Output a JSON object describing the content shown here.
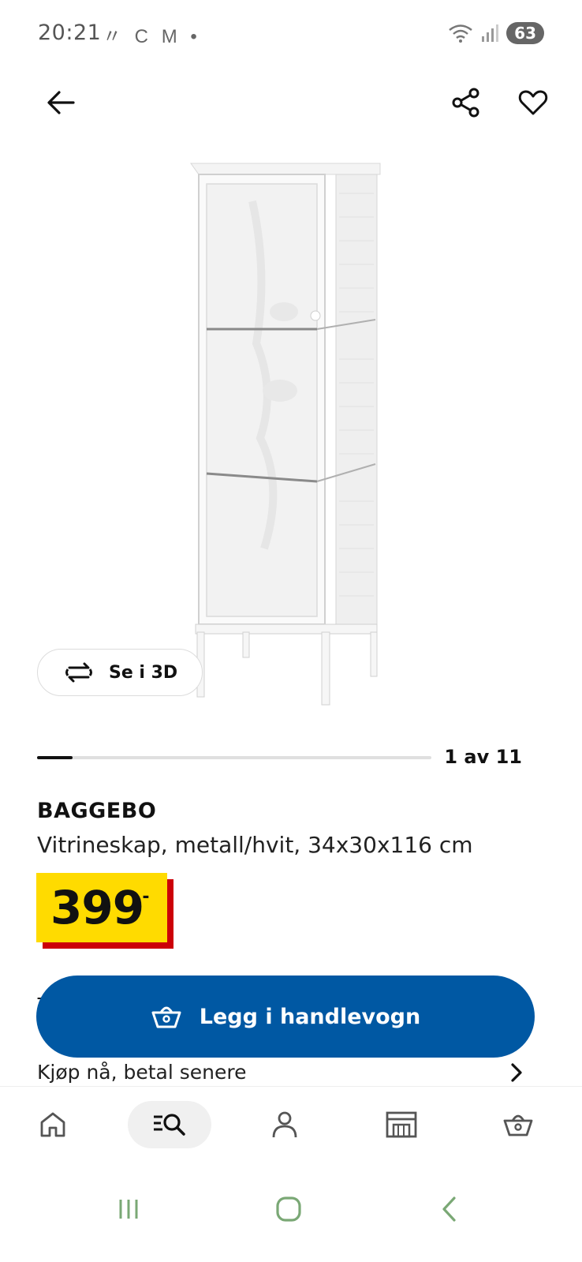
{
  "status_bar": {
    "time": "20:21",
    "left_icons": [
      "〃",
      "C",
      "M",
      "•"
    ],
    "battery": "63"
  },
  "top_bar": {
    "back_icon": "arrow-left-icon",
    "share_icon": "share-icon",
    "favorite_icon": "heart-icon"
  },
  "gallery": {
    "view_3d_label": "Se i 3D",
    "counter": "1 av 11",
    "current_index": 1,
    "total_images": 11
  },
  "product": {
    "name": "BAGGEBO",
    "description": "Vitrineskap, metall/hvit, 34x30x116 cm",
    "price": "399",
    "price_suffix": ",-"
  },
  "colors": {
    "cart_button": "#0058a3",
    "price_bg": "#ffdb00",
    "price_shadow": "#cc0008"
  },
  "partial_text": "T",
  "actions": {
    "add_to_cart_label": "Legg i handlevogn",
    "buy_now_label": "Kjøp nå, betal senere"
  },
  "bottom_nav": {
    "items": [
      "home-icon",
      "search-list-icon",
      "profile-icon",
      "store-icon",
      "cart-icon"
    ],
    "active": "search-list-icon"
  },
  "system_nav": [
    "recents-icon",
    "home-circle-icon",
    "back-chevron-icon"
  ]
}
